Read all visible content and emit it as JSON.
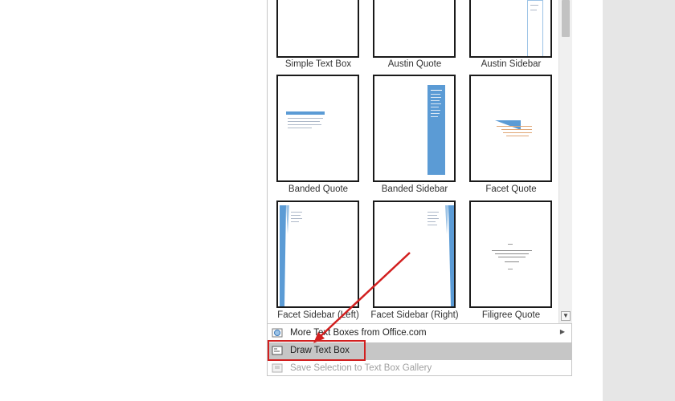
{
  "gallery": {
    "items": [
      {
        "label": "Simple Text Box"
      },
      {
        "label": "Austin Quote"
      },
      {
        "label": "Austin Sidebar"
      },
      {
        "label": "Banded Quote"
      },
      {
        "label": "Banded Sidebar"
      },
      {
        "label": "Facet Quote"
      },
      {
        "label": "Facet Sidebar (Left)"
      },
      {
        "label": "Facet Sidebar (Right)"
      },
      {
        "label": "Filigree Quote"
      }
    ]
  },
  "menu": {
    "more": "More Text Boxes from Office.com",
    "draw": "Draw Text Box",
    "save": "Save Selection to Text Box Gallery"
  },
  "colors": {
    "accent": "#5b9bd5",
    "highlight": "#d21f1f",
    "selected": "#c6c6c6"
  }
}
